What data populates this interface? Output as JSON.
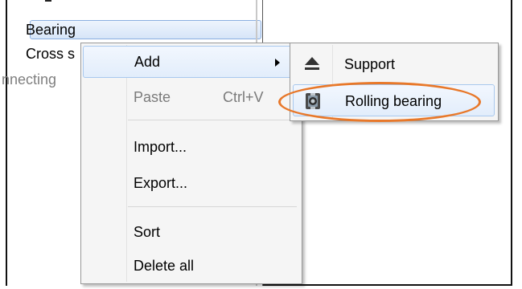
{
  "tree": {
    "items": [
      {
        "label": "Bearing",
        "selected": true
      },
      {
        "label": "Cross s",
        "selected": false
      },
      {
        "label": "nnecting",
        "selected": false,
        "dimmed": true
      }
    ]
  },
  "context_menu": {
    "items": [
      {
        "label": "Add",
        "has_submenu": true,
        "hover": true
      },
      {
        "label": "Paste",
        "shortcut": "Ctrl+V",
        "disabled": true
      },
      {
        "label": "Import..."
      },
      {
        "label": "Export..."
      },
      {
        "label": "Sort"
      },
      {
        "label": "Delete all"
      }
    ]
  },
  "submenu": {
    "items": [
      {
        "label": "Support",
        "icon": "support-icon"
      },
      {
        "label": "Rolling bearing",
        "icon": "rolling-bearing-icon",
        "hover": true,
        "highlighted": true
      }
    ]
  },
  "colors": {
    "highlight_ring": "#e8782a",
    "selection_border": "#8aaee0",
    "menu_background": "#f5f5f5"
  }
}
